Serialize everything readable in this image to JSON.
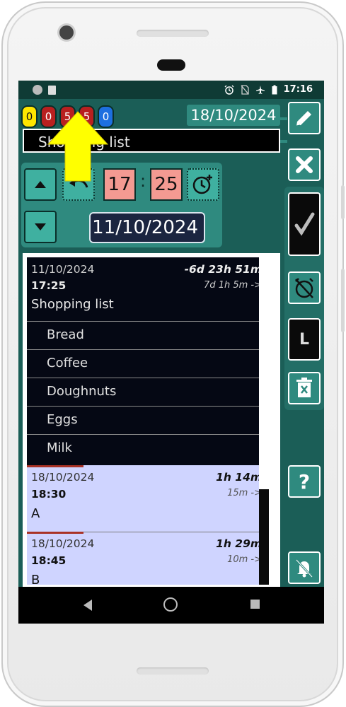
{
  "status_bar": {
    "time": "17:16",
    "icons": [
      "circle-icon",
      "sd-card-icon",
      "alarm-icon",
      "no-sim-icon",
      "airplane-icon",
      "battery-icon"
    ]
  },
  "counters": [
    {
      "value": "0",
      "color": "#ffe600"
    },
    {
      "value": "0",
      "color": "#b82020"
    },
    {
      "value": "5",
      "color": "#b82020"
    },
    {
      "value": "5",
      "color": "#b82020"
    },
    {
      "value": "0",
      "color": "#1d6fe0"
    }
  ],
  "header": {
    "date": "18/10/2024",
    "title": "Shopping list"
  },
  "time_editor": {
    "hour": "17",
    "minute": "25",
    "date": "11/10/2024"
  },
  "list": {
    "current": {
      "date": "11/10/2024",
      "time": "17:25",
      "relative": "-6d 23h 51m",
      "repeat": "7d 1h 5m ->",
      "title": "Shopping list",
      "items": [
        "Bread",
        "Coffee",
        "Doughnuts",
        "Eggs",
        "Milk"
      ]
    },
    "entries": [
      {
        "date": "18/10/2024",
        "time": "18:30",
        "relative": "1h 14m",
        "repeat": "15m ->",
        "name": "A"
      },
      {
        "date": "18/10/2024",
        "time": "18:45",
        "relative": "1h 29m",
        "repeat": "10m ->",
        "name": "B"
      }
    ]
  },
  "right_rail": {
    "buttons": [
      "edit-icon",
      "close-icon",
      "check-icon",
      "alarm-off-icon",
      "L",
      "trash-icon",
      "?",
      "notifications-off-icon"
    ]
  },
  "colors": {
    "accent": "#2f8a7f",
    "background": "#1b5e57",
    "highlight": "#ffff00"
  }
}
